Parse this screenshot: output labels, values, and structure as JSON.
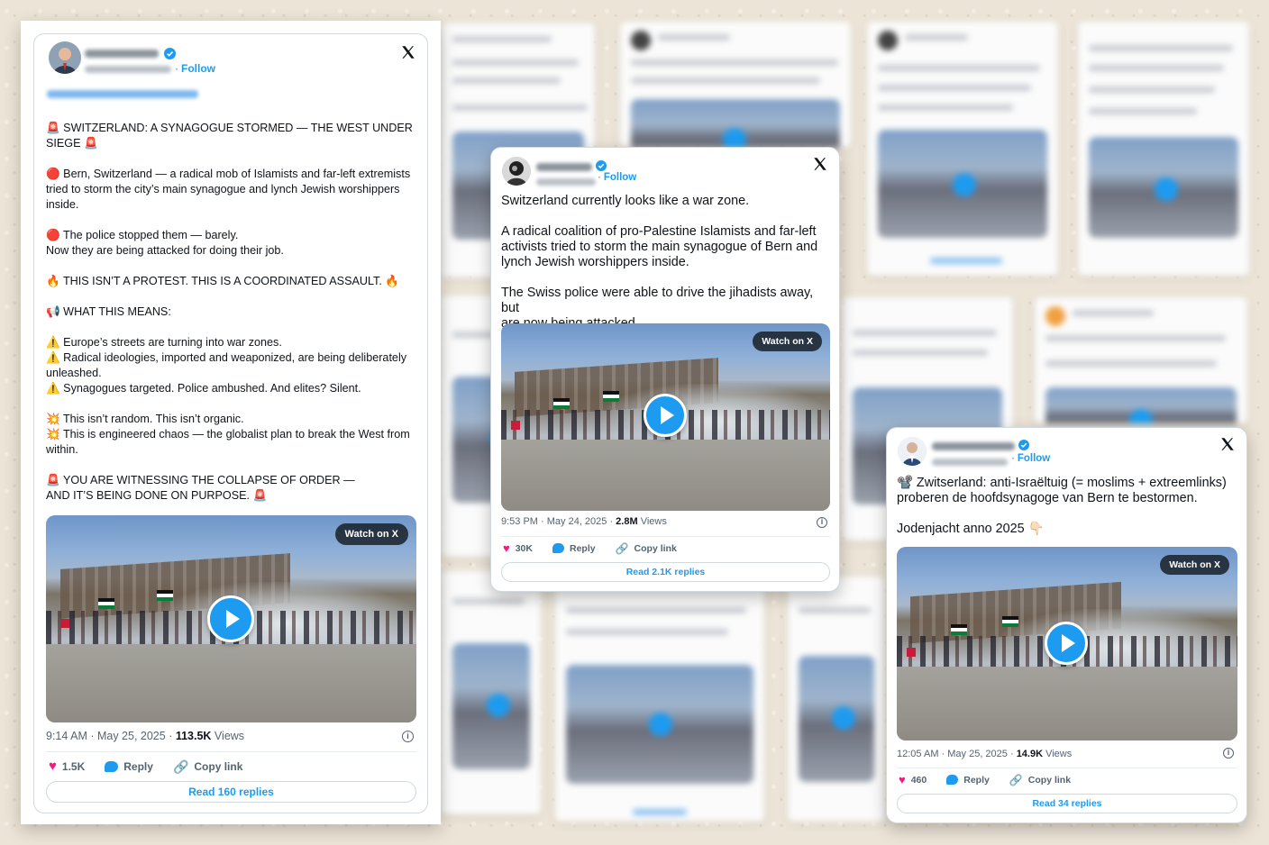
{
  "tweets": [
    {
      "follow_label": "Follow",
      "text_lines": [
        [
          "🚨 SWITZERLAND: A SYNAGOGUE STORMED — THE WEST UNDER",
          "SIEGE 🚨"
        ],
        [
          "🔴 Bern, Switzerland — a radical mob of Islamists and far-left extremists",
          "tried to storm the city’s main synagogue and lynch Jewish worshippers",
          "inside."
        ],
        [
          "🔴 The police stopped them — barely.",
          "Now they are being attacked for doing their job."
        ],
        [
          "🔥 THIS ISN’T A PROTEST. THIS IS A COORDINATED ASSAULT. 🔥"
        ],
        [
          "📢 WHAT THIS MEANS:"
        ],
        [
          "⚠️ Europe’s streets are turning into war zones.",
          "⚠️ Radical ideologies, imported and weaponized, are being deliberately",
          "unleashed.",
          "⚠️ Synagogues targeted. Police ambushed. And elites? Silent."
        ],
        [
          "💥 This isn’t random. This isn’t organic.",
          "💥 This is engineered chaos — the globalist plan to break the West from",
          "within."
        ],
        [
          "🚨 YOU ARE WITNESSING THE COLLAPSE OF ORDER —",
          "AND IT’S BEING DONE ON PURPOSE. 🚨"
        ]
      ],
      "watch_label": "Watch on X",
      "time": "9:14 AM · May 25, 2025 · ",
      "views_count": "113.5K",
      "views_label": " Views",
      "likes": "1.5K",
      "reply_label": "Reply",
      "copy_label": "Copy link",
      "replies_button": "Read 160 replies"
    },
    {
      "follow_label": "Follow",
      "text_lines": [
        [
          "Switzerland currently looks like a war zone."
        ],
        [
          "A radical coalition of pro-Palestine Islamists and far-left",
          "activists tried to storm the main synagogue of Bern and",
          "lynch Jewish worshippers inside."
        ],
        [
          "The Swiss police were able to drive the jihadists away, but",
          "are now being attacked."
        ]
      ],
      "watch_label": "Watch on X",
      "time": "9:53 PM · May 24, 2025 · ",
      "views_count": "2.8M",
      "views_label": " Views",
      "likes": "30K",
      "reply_label": "Reply",
      "copy_label": "Copy link",
      "replies_button": "Read 2.1K replies"
    },
    {
      "follow_label": "Follow",
      "text_lines": [
        [
          "📽️ Zwitserland: anti-Israëltuig (= moslims + extreemlinks)",
          "proberen de hoofdsynagoge van Bern te bestormen."
        ],
        [
          "Jodenjacht anno 2025 👇🏻"
        ]
      ],
      "watch_label": "Watch on X",
      "time": "12:05 AM · May 25, 2025 · ",
      "views_count": "14.9K",
      "views_label": " Views",
      "likes": "460",
      "reply_label": "Reply",
      "copy_label": "Copy link",
      "replies_button": "Read 34 replies"
    }
  ],
  "colors": {
    "accent": "#1d9bf0",
    "like": "#f91880",
    "background": "#ece4d6"
  },
  "icons": [
    "x-logo-icon",
    "verified-badge-icon",
    "play-icon",
    "heart-icon",
    "reply-bubble-icon",
    "link-icon",
    "info-icon"
  ]
}
